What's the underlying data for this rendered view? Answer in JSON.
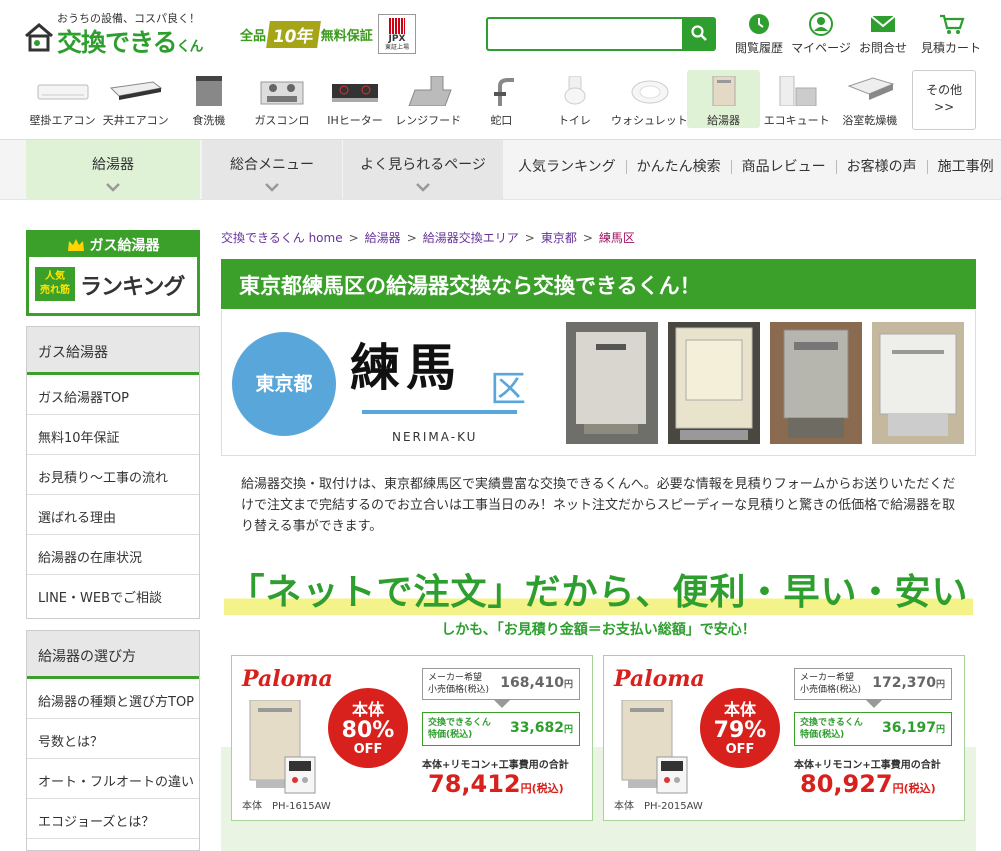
{
  "header": {
    "tagline": "おうちの設備、コスパ良く！",
    "logo_main": "交換できる",
    "logo_small": "くん",
    "warranty_pre": "全品",
    "warranty_num": "10年",
    "warranty_post": "無料保証",
    "jpx_title": "JPX",
    "jpx_sub": "東証上場",
    "search_value": "",
    "icons": [
      {
        "label": "閲覧履歴",
        "icon": "history-icon"
      },
      {
        "label": "マイページ",
        "icon": "user-icon"
      },
      {
        "label": "お問合せ",
        "icon": "mail-icon"
      },
      {
        "label": "見積カート",
        "icon": "cart-icon"
      }
    ]
  },
  "categories": [
    {
      "label": "壁掛エアコン"
    },
    {
      "label": "天井エアコン"
    },
    {
      "label": "食洗機"
    },
    {
      "label": "ガスコンロ"
    },
    {
      "label": "IHヒーター"
    },
    {
      "label": "レンジフード"
    },
    {
      "label": "蛇口"
    },
    {
      "label": "トイレ"
    },
    {
      "label": "ウォシュレット"
    },
    {
      "label": "給湯器"
    },
    {
      "label": "エコキュート"
    },
    {
      "label": "浴室乾燥機"
    }
  ],
  "categories_more": {
    "line1": "その他",
    "line2": ">>"
  },
  "menubar": {
    "tabs": [
      "給湯器",
      "総合メニュー",
      "よく見られるページ"
    ],
    "links": [
      "人気ランキング",
      "かんたん検索",
      "商品レビュー",
      "お客様の声",
      "施工事例"
    ]
  },
  "sidebar": {
    "rank_top": "ガス給湯器",
    "rank_badge1": "人気",
    "rank_badge2": "売れ筋",
    "rank_text": "ランキング",
    "section1": {
      "title": "ガス給湯器",
      "items": [
        "ガス給湯器TOP",
        "無料10年保証",
        "お見積り～工事の流れ",
        "選ばれる理由",
        "給湯器の在庫状況",
        "LINE・WEBでご相談"
      ]
    },
    "section2": {
      "title": "給湯器の選び方",
      "items": [
        "給湯器の種類と選び方TOP",
        "号数とは？",
        "オート・フルオートの違い",
        "エコジョーズとは？"
      ]
    }
  },
  "breadcrumb": [
    "交換できるくん home",
    "給湯器",
    "給湯器交換エリア",
    "東京都",
    "練馬区"
  ],
  "breadcrumb_sep": ">",
  "title": "東京都練馬区の給湯器交換なら交換できるくん！",
  "hero": {
    "pref": "東京都",
    "city": "練馬",
    "ku": "区",
    "roman": "NERIMA-KU"
  },
  "description": "給湯器交換・取付けは、東京都練馬区で実績豊富な交換できるくんへ。必要な情報を見積りフォームからお送りいただくだけで注文まで完結するのでお立合いは工事当日のみ！ネット注文だからスピーディーな見積りと驚きの低価格で給湯器を取り替える事ができます。",
  "catch": {
    "main": "「ネットで注文」だから、便利・早い・安い",
    "sub": "しかも、「お見積り金額＝お支払い総額」で安心！"
  },
  "products": [
    {
      "brand": "Paloma",
      "model": "本体　PH-1615AW",
      "off_a": "本体",
      "off_b": "80%",
      "off_c": "OFF",
      "maker_label1": "メーカー希望",
      "maker_label2": "小売価格(税込)",
      "maker_price": "168,410",
      "yen": "円",
      "special_label1": "交換できるくん",
      "special_label2": "特価(税込)",
      "special_price": "33,682",
      "total_label": "本体+リモコン+工事費用の合計",
      "total_price": "78,412",
      "total_unit": "円(税込)"
    },
    {
      "brand": "Paloma",
      "model": "本体　PH-2015AW",
      "off_a": "本体",
      "off_b": "79%",
      "off_c": "OFF",
      "maker_label1": "メーカー希望",
      "maker_label2": "小売価格(税込)",
      "maker_price": "172,370",
      "yen": "円",
      "special_label1": "交換できるくん",
      "special_label2": "特価(税込)",
      "special_price": "36,197",
      "total_label": "本体+リモコン+工事費用の合計",
      "total_price": "80,927",
      "total_unit": "円(税込)"
    }
  ],
  "colors": {
    "brand_green": "#3aa02a",
    "accent_blue": "#59a6db",
    "sale_red": "#d8201c"
  }
}
